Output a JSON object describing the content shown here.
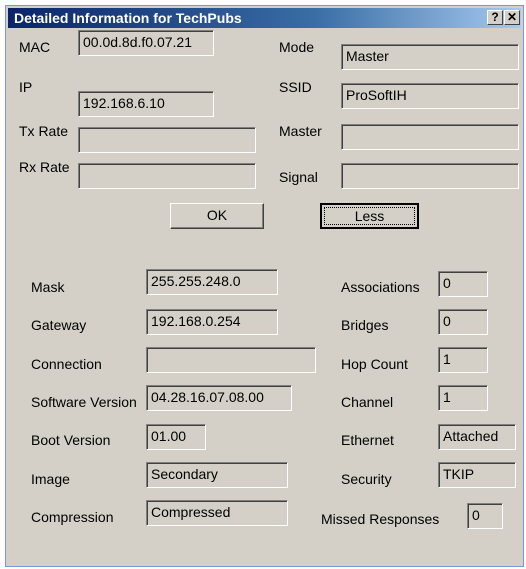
{
  "window": {
    "title": "Detailed Information for TechPubs",
    "help_label": "?",
    "close_label": "✕"
  },
  "top_fields": {
    "mac": {
      "label": "MAC",
      "value": "00.0d.8d.f0.07.21"
    },
    "ip": {
      "label": "IP",
      "value": "192.168.6.10"
    },
    "tx_rate": {
      "label": "Tx Rate",
      "value": ""
    },
    "rx_rate": {
      "label": "Rx Rate",
      "value": ""
    },
    "mode": {
      "label": "Mode",
      "value": "Master"
    },
    "ssid": {
      "label": "SSID",
      "value": "ProSoftIH"
    },
    "master": {
      "label": "Master",
      "value": ""
    },
    "signal": {
      "label": "Signal",
      "value": ""
    }
  },
  "buttons": {
    "ok": "OK",
    "less": "Less"
  },
  "details_left": {
    "mask": {
      "label": "Mask",
      "value": "255.255.248.0"
    },
    "gateway": {
      "label": "Gateway",
      "value": "192.168.0.254"
    },
    "connection": {
      "label": "Connection",
      "value": ""
    },
    "software_version": {
      "label": "Software Version",
      "value": "04.28.16.07.08.00"
    },
    "boot_version": {
      "label": "Boot Version",
      "value": "01.00"
    },
    "image": {
      "label": "Image",
      "value": "Secondary"
    },
    "compression": {
      "label": "Compression",
      "value": "Compressed"
    }
  },
  "details_right": {
    "associations": {
      "label": "Associations",
      "value": "0"
    },
    "bridges": {
      "label": "Bridges",
      "value": "0"
    },
    "hop_count": {
      "label": "Hop Count",
      "value": "1"
    },
    "channel": {
      "label": "Channel",
      "value": "1"
    },
    "ethernet": {
      "label": "Ethernet",
      "value": "Attached"
    },
    "security": {
      "label": "Security",
      "value": "TKIP"
    },
    "missed_responses": {
      "label": "Missed Responses",
      "value": "0"
    }
  }
}
